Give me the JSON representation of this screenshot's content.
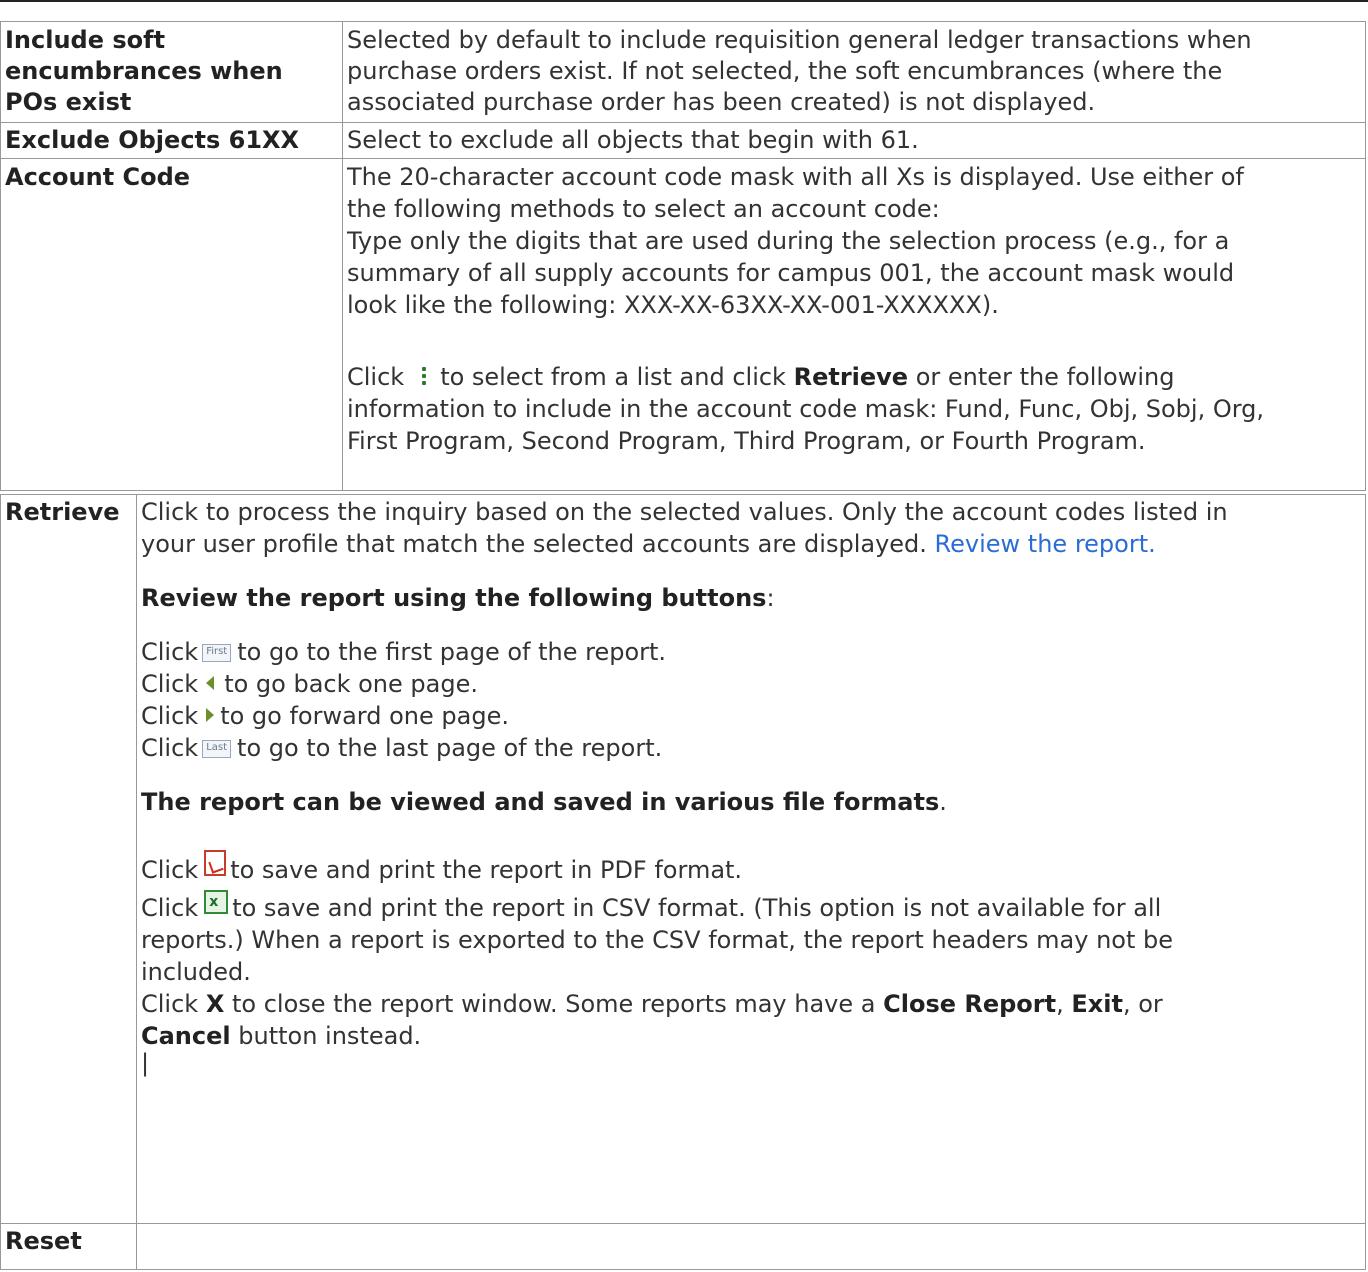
{
  "rows": {
    "soft_enc": {
      "key": "Include soft encumbrances when POs exist",
      "lines": [
        "Selected by default to include requisition general ledger transactions when",
        "purchase orders exist. If not selected, the soft encumbrances (where the",
        "associated purchase order has been created) is not displayed."
      ]
    },
    "exclude": {
      "key": "Exclude Objects 61XX",
      "text": "Select to exclude all objects that begin with 61."
    },
    "account": {
      "key": "Account Code",
      "lines": [
        "The 20-character account code mask with all Xs is displayed. Use either of",
        "the following methods to select an account code:",
        "Type only the digits that are used during the selection process (e.g., for a",
        "summary of all supply accounts for campus 001, the account mask would",
        "look like the following: XXX-XX-63XX-XX-001-XXXXXX)."
      ],
      "click": "Click",
      "click_rest_a": "to select from a list and click",
      "retrieve": "Retrieve",
      "click_rest_b": "or enter the following",
      "line2": "information to include in the account code mask: Fund, Func, Obj, Sobj, Org,",
      "line3": "First Program, Second Program, Third Program, or Fourth Program."
    },
    "retrieve": {
      "key": "Retrieve",
      "line1": "Click to process the inquiry based on the selected values. Only the account codes listed in",
      "line2": "your user profile that match the selected accounts are displayed.",
      "link": "Review the report.",
      "review_heading": "Review the report using the following buttons",
      "colon": ":",
      "click": "Click",
      "first_label": "First",
      "first_text": "to go to the first page of the report.",
      "back_text": "to go back one page.",
      "fwd_text": "to go forward one page.",
      "last_label": "Last",
      "last_text": "to go to the last page of the report.",
      "formats_heading": "The report can be viewed and saved in various file formats",
      "period": ".",
      "pdf_text": "to save and print the report in PDF format.",
      "csv_line1": "to save and print the report in CSV format. (This option is not available for all",
      "csv_line2": "reports.) When a report is exported to the CSV format, the report headers may not be",
      "csv_line3": "included.",
      "x_a": "Click",
      "x_b": "X",
      "x_c": "to close the report window. Some reports may have a",
      "close_report": "Close Report",
      "comma": ",",
      "exit": "Exit",
      "or": ", or",
      "cancel": "Cancel",
      "instead": "button instead.",
      "pipe": "|"
    },
    "reset": {
      "key": "Reset"
    }
  }
}
